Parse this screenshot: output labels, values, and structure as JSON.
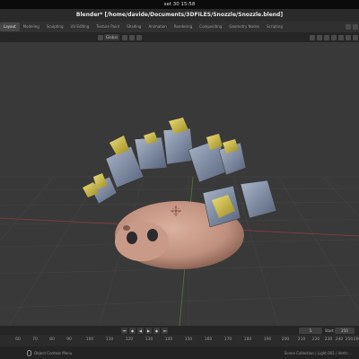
{
  "system": {
    "clock": "set 30 15:58"
  },
  "window": {
    "title": "Blender* [/home/davide/Documents/3DFILES/Snozzle/Snozzle.blend]"
  },
  "workspace_tabs": [
    "Layout",
    "Modeling",
    "Sculpting",
    "UV Editing",
    "Texture Paint",
    "Shading",
    "Animation",
    "Rendering",
    "Compositing",
    "Geometry Nodes",
    "Scripting"
  ],
  "active_tab_index": 0,
  "toolbar": {
    "transform_orientation": "Global"
  },
  "timeline": {
    "current_frame": "1",
    "start_label": "Start",
    "end_frame": "250",
    "ruler_ticks": [
      "60",
      "70",
      "80",
      "90",
      "100",
      "110",
      "120",
      "130",
      "140",
      "150",
      "160",
      "170",
      "180",
      "190",
      "200",
      "210",
      "220",
      "230",
      "240",
      "250",
      "260"
    ]
  },
  "status": {
    "left_text": "Object Context Menu",
    "right_text": "Scene Collection | Light.001 | Verts:..."
  },
  "colors": {
    "body": "#c99a87",
    "crystal": "#7b8ba6",
    "gold": "#c7b33a",
    "eye": "#2b2b2e"
  }
}
